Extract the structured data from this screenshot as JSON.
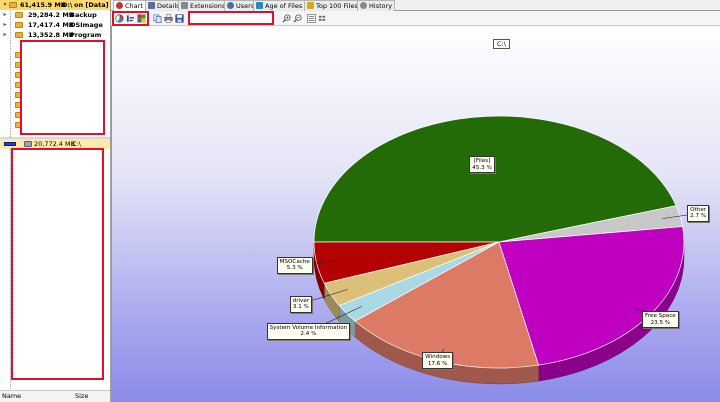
{
  "tree": {
    "root": {
      "size": "61,415.9 MB",
      "name": "D:\\",
      "suffix": "on  [Data]"
    },
    "items": [
      {
        "size": "29,284.2 MB",
        "name": "Backup"
      },
      {
        "size": "17,417.4 MB",
        "name": "OSImage"
      },
      {
        "size": "13,352.8 MB",
        "name": "Program"
      }
    ],
    "drive": {
      "size": "20,772.4 MB",
      "name": "C:\\"
    },
    "columns": {
      "name": "Name",
      "size": "Size"
    }
  },
  "tabs": [
    {
      "label": "Chart",
      "color": "#c0392b",
      "active": true
    },
    {
      "label": "Details",
      "color": "#5a6e9b"
    },
    {
      "label": "Extensions",
      "color": "#7f8c8d"
    },
    {
      "label": "Users",
      "color": "#4a6fa5"
    },
    {
      "label": "Age of Files",
      "color": "#2e86c1"
    },
    {
      "label": "Top 100 Files",
      "color": "#d4ac0d"
    },
    {
      "label": "History",
      "color": "#7f8c8d"
    }
  ],
  "toolbar": {
    "search": {
      "value": ""
    },
    "icons": [
      "pie-chart-icon",
      "bar-chart-icon",
      "treemap-icon",
      "copy-icon",
      "print-icon",
      "save-icon",
      "zoom-in-icon",
      "zoom-out-icon",
      "list-view-icon",
      "settings-icon"
    ]
  },
  "chart_data": {
    "type": "pie",
    "title": "C:\\",
    "labels": [
      "[Files]",
      "Other",
      "Free Space",
      "Windows",
      "System Volume Information",
      "driver",
      "MSOCache"
    ],
    "values": [
      45.3,
      2.7,
      23.5,
      17.6,
      2.4,
      3.1,
      5.3
    ],
    "value_labels": [
      "45.3 %",
      "2.7 %",
      "23.5 %",
      "17.6 %",
      "2.4 %",
      "3.1 %",
      "5.3 %"
    ],
    "colors": [
      "#226b06",
      "#c8c8c8",
      "#c000c0",
      "#dd7a66",
      "#a9d9e3",
      "#dcc07a",
      "#b30000"
    ],
    "background": [
      "#ffffff",
      "#8b8bea"
    ]
  }
}
